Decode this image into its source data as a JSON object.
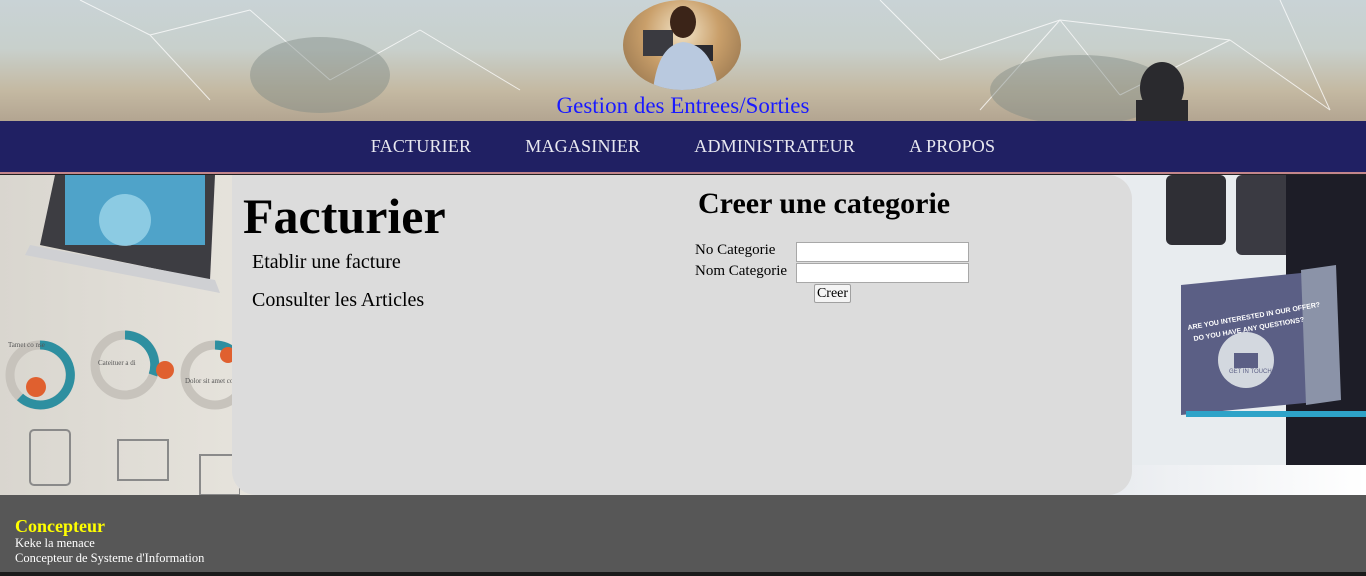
{
  "header": {
    "site_title": "Gestion des Entrees/Sorties",
    "avatar_icon": "person-photo"
  },
  "nav": {
    "items": [
      {
        "label": "FACTURIER"
      },
      {
        "label": "MAGASINIER"
      },
      {
        "label": "ADMINISTRATEUR"
      },
      {
        "label": "A PROPOS"
      }
    ]
  },
  "sidebar": {
    "title": "Facturier",
    "links": [
      {
        "label": "Etablir une facture"
      },
      {
        "label": "Consulter les Articles"
      }
    ]
  },
  "form": {
    "title": "Creer une categorie",
    "fields": [
      {
        "label": "No Categorie",
        "value": ""
      },
      {
        "label": "Nom Categorie",
        "value": ""
      }
    ],
    "submit_label": "Creer"
  },
  "decor": {
    "left_texts": [
      "Tamet co nse ctetuer adipiscing elit nean",
      "Cateituer a di piscing elit nean commodo ligula",
      "Dolor sit amet co nse ctetuer adip iscing elit nean"
    ],
    "left_percents": [
      "50%",
      "25%",
      "12%"
    ],
    "right_banner": "ARE YOU INTERESTED IN OUR OFFER? DO YOU HAVE ANY QUESTIONS?",
    "right_button": "GET IN TOUCH"
  },
  "footer": {
    "title": "Concepteur",
    "lines": [
      "Keke la menace",
      "Concepteur de Systeme d'Information"
    ]
  },
  "colors": {
    "nav_bg": "#202063",
    "panel_bg": "#dcdcdc",
    "footer_bg": "#575757",
    "footer_title": "#ffff00",
    "site_title": "#1a1aff"
  }
}
